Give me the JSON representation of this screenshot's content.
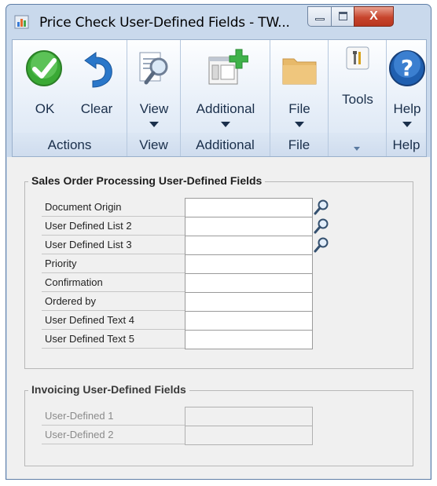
{
  "window": {
    "title": "Price Check User-Defined Fields  -  TW...",
    "close_glyph": "X"
  },
  "ribbon": {
    "groups": [
      {
        "label": "Actions",
        "buttons": [
          {
            "label": "OK",
            "icon": "check-icon"
          },
          {
            "label": "Clear",
            "icon": "undo-arrow-icon"
          }
        ]
      },
      {
        "label": "View",
        "buttons": [
          {
            "label": "View",
            "icon": "magnify-document-icon"
          }
        ]
      },
      {
        "label": "Additional",
        "buttons": [
          {
            "label": "Additional",
            "icon": "add-window-icon"
          }
        ]
      },
      {
        "label": "File",
        "buttons": [
          {
            "label": "File",
            "icon": "folder-icon"
          }
        ]
      },
      {
        "label": "",
        "buttons": [
          {
            "label": "Tools",
            "icon": "tools-icon"
          }
        ]
      },
      {
        "label": "Help",
        "buttons": [
          {
            "label": "Help",
            "icon": "help-icon"
          }
        ]
      }
    ]
  },
  "sop": {
    "title": "Sales Order Processing User-Defined Fields",
    "fields": [
      {
        "label": "Document Origin",
        "value": "",
        "lookup": true
      },
      {
        "label": "User Defined List 2",
        "value": "",
        "lookup": true
      },
      {
        "label": "User Defined List 3",
        "value": "",
        "lookup": true
      },
      {
        "label": "Priority",
        "value": "",
        "lookup": false
      },
      {
        "label": "Confirmation",
        "value": "",
        "lookup": false
      },
      {
        "label": "Ordered by",
        "value": "",
        "lookup": false
      },
      {
        "label": "User Defined Text 4",
        "value": "",
        "lookup": false
      },
      {
        "label": "User Defined Text 5",
        "value": "",
        "lookup": false
      }
    ]
  },
  "invoicing": {
    "title": "Invoicing User-Defined Fields",
    "fields": [
      {
        "label": "User-Defined 1",
        "value": ""
      },
      {
        "label": "User-Defined 2",
        "value": ""
      }
    ]
  },
  "colors": {
    "accent_green": "#3aa935",
    "accent_blue": "#1f5fb0",
    "folder": "#e7b96a"
  }
}
